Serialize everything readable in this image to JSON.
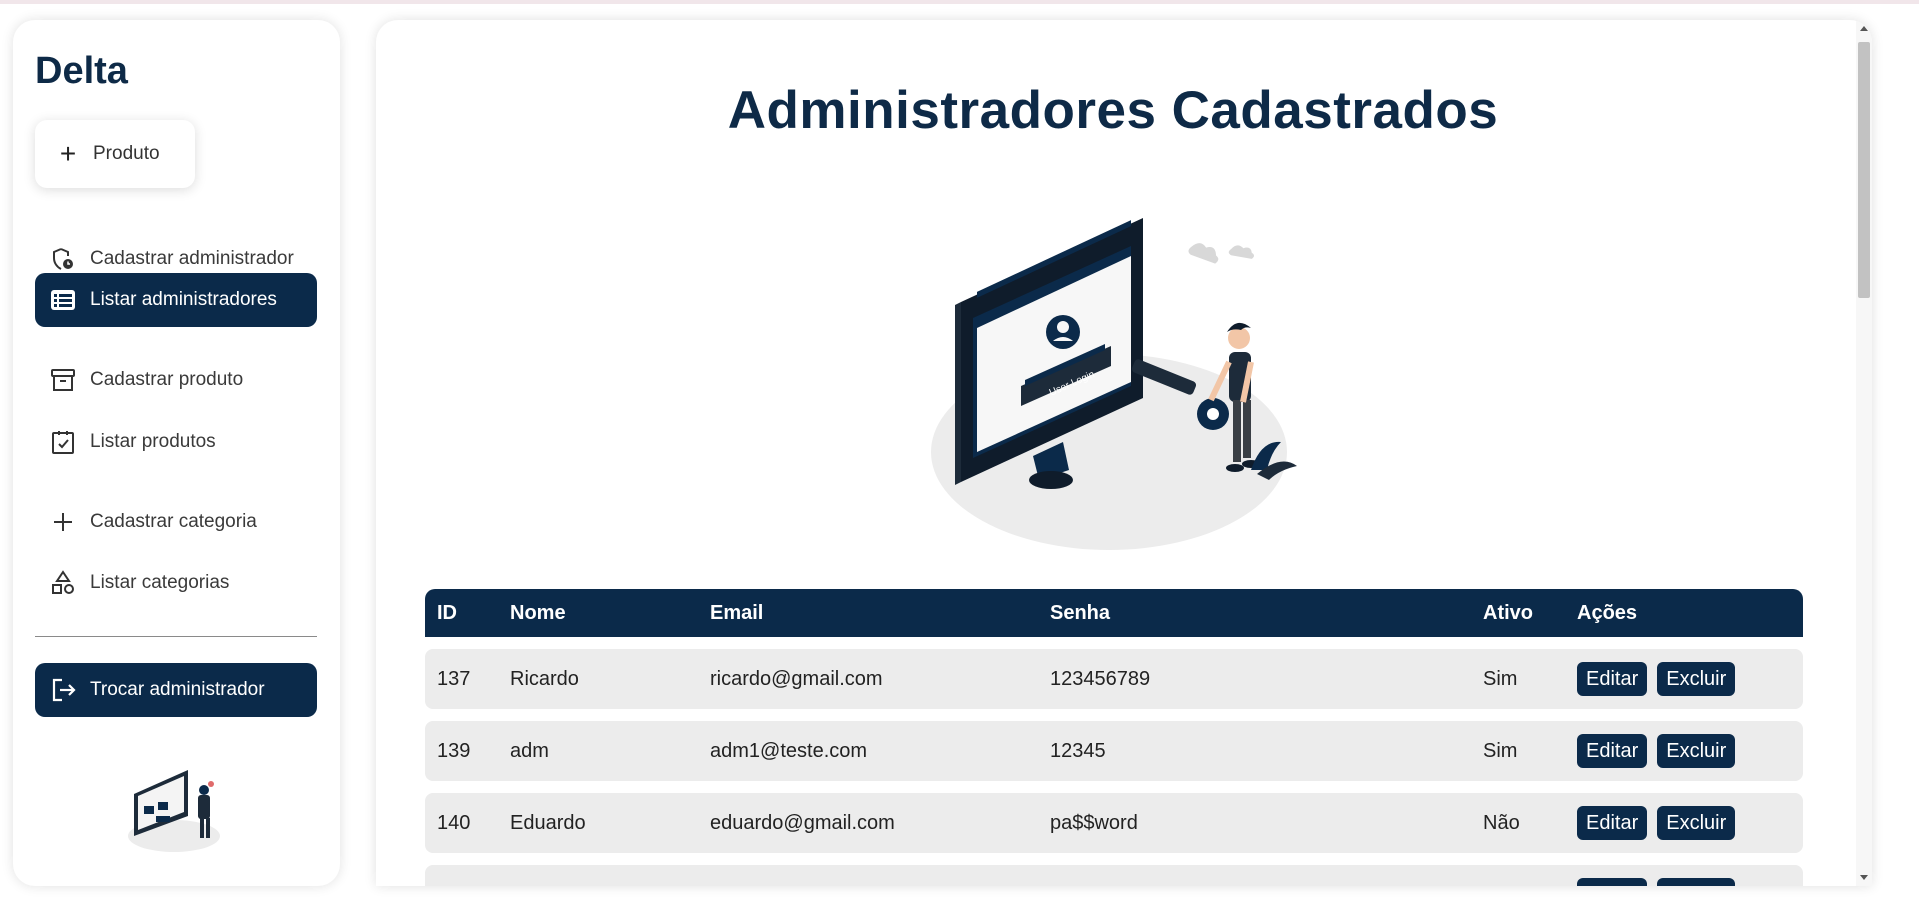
{
  "sidebar": {
    "brand": "Delta",
    "produto_button": "Produto",
    "items": [
      {
        "label": "Cadastrar administrador",
        "icon": "shield-clock-icon"
      },
      {
        "label": "Listar administradores",
        "icon": "list-icon"
      },
      {
        "label": "Cadastrar produto",
        "icon": "archive-box-icon"
      },
      {
        "label": "Listar produtos",
        "icon": "clipboard-check-icon"
      },
      {
        "label": "Cadastrar categoria",
        "icon": "plus-icon"
      },
      {
        "label": "Listar categorias",
        "icon": "shapes-icon"
      },
      {
        "label": "Trocar administrador",
        "icon": "logout-icon"
      }
    ]
  },
  "main": {
    "title": "Administradores Cadastrados",
    "hero_text": "User Login",
    "table": {
      "headers": [
        "ID",
        "Nome",
        "Email",
        "Senha",
        "Ativo",
        "Ações"
      ],
      "rows": [
        {
          "id": "137",
          "nome": "Ricardo",
          "email": "ricardo@gmail.com",
          "senha": "123456789",
          "ativo": "Sim"
        },
        {
          "id": "139",
          "nome": "adm",
          "email": "adm1@teste.com",
          "senha": "12345",
          "ativo": "Sim"
        },
        {
          "id": "140",
          "nome": "Eduardo",
          "email": "eduardo@gmail.com",
          "senha": "pa$$word",
          "ativo": "Não"
        }
      ],
      "edit_label": "Editar",
      "delete_label": "Excluir"
    }
  },
  "colors": {
    "primary": "#0b2a4a",
    "row_bg": "#ececec"
  }
}
